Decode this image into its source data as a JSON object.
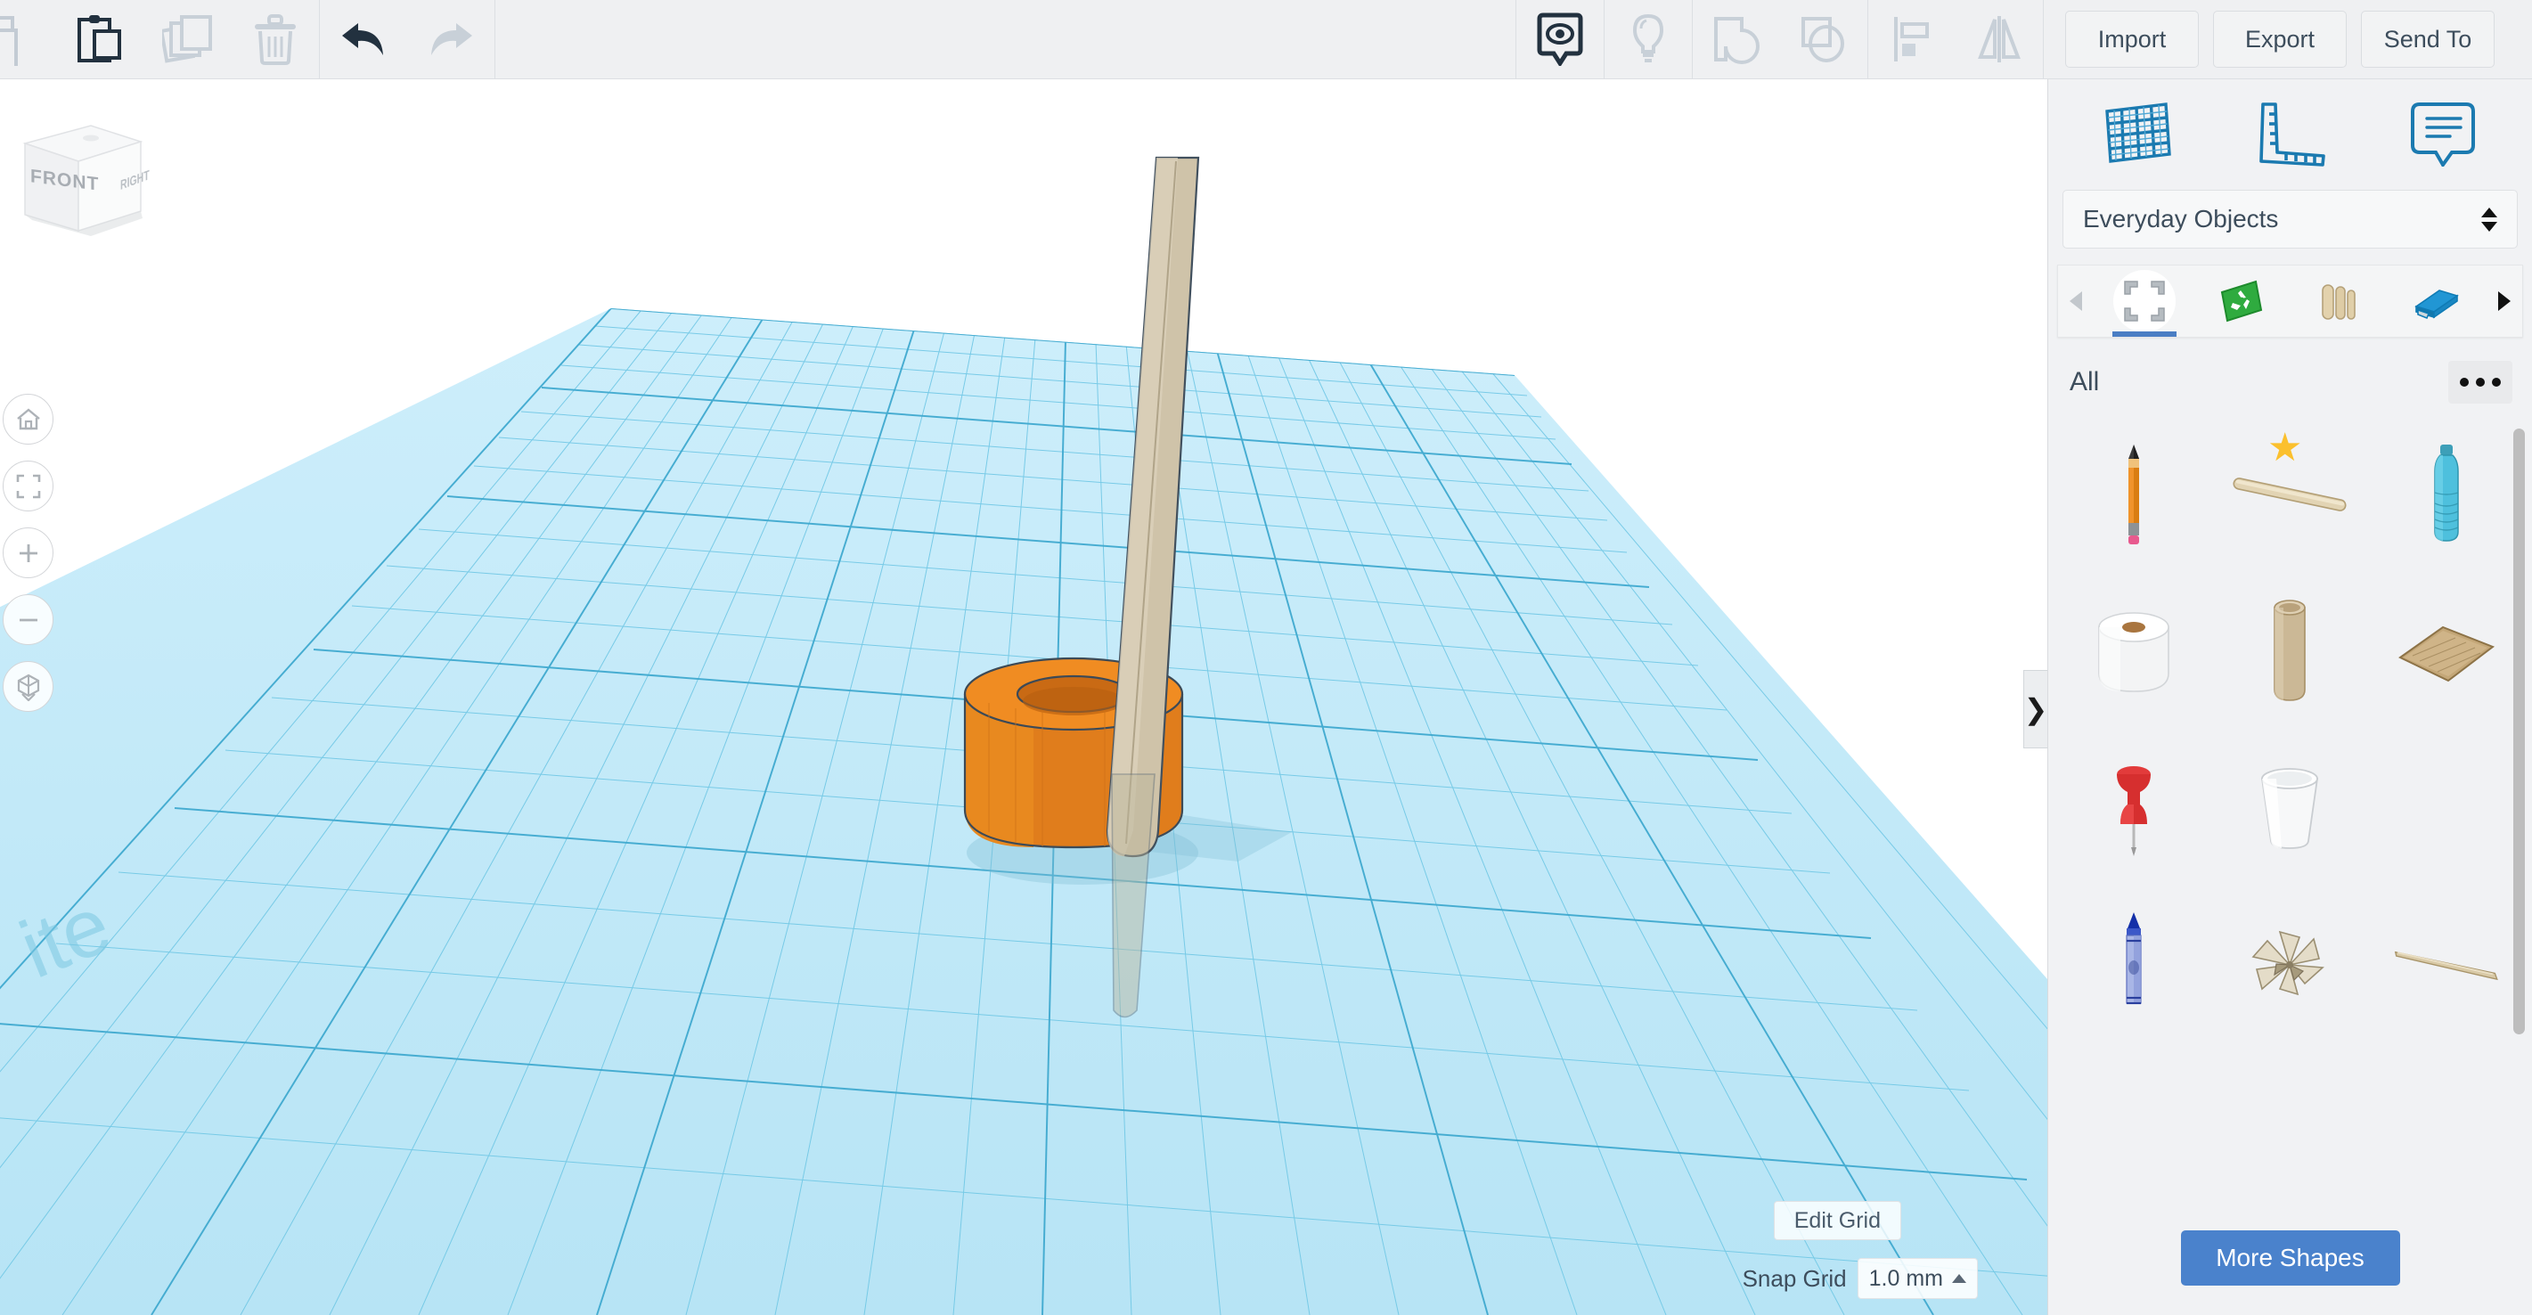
{
  "toolbar": {
    "left_tools": [
      {
        "name": "copy-icon",
        "label": "Copy"
      },
      {
        "name": "paste-icon",
        "label": "Paste"
      },
      {
        "name": "duplicate-icon",
        "label": "Duplicate"
      },
      {
        "name": "delete-icon",
        "label": "Delete"
      }
    ],
    "history_tools": [
      {
        "name": "undo-icon",
        "label": "Undo"
      },
      {
        "name": "redo-icon",
        "label": "Redo"
      }
    ],
    "view_tools": [
      {
        "name": "show-hide-icon",
        "label": "Show/Hide"
      },
      {
        "name": "lightbulb-icon",
        "label": "Light"
      },
      {
        "name": "group-icon",
        "label": "Group"
      },
      {
        "name": "ungroup-icon",
        "label": "Ungroup"
      },
      {
        "name": "align-icon",
        "label": "Align"
      },
      {
        "name": "mirror-icon",
        "label": "Mirror"
      }
    ],
    "actions": [
      {
        "name": "import-button",
        "label": "Import"
      },
      {
        "name": "export-button",
        "label": "Export"
      },
      {
        "name": "send-to-button",
        "label": "Send To"
      }
    ]
  },
  "canvas": {
    "viewcube": {
      "front_label": "FRONT",
      "right_label": "RIGHT"
    },
    "nav_buttons": [
      {
        "name": "home-view-button",
        "icon": "home-icon"
      },
      {
        "name": "fit-to-view-button",
        "icon": "fit-view-icon"
      },
      {
        "name": "zoom-in-button",
        "icon": "plus-icon"
      },
      {
        "name": "zoom-out-button",
        "icon": "minus-icon"
      },
      {
        "name": "projection-toggle-button",
        "icon": "cube-perspective-icon"
      }
    ],
    "collapse_tab": "❯",
    "edit_grid_label": "Edit Grid",
    "snap_grid_label": "Snap Grid",
    "snap_grid_value": "1.0 mm",
    "objects": [
      {
        "name": "orange-tube-object",
        "color": "#E8821E"
      },
      {
        "name": "craft-stick-object",
        "color": "#CFC3AA"
      }
    ],
    "grid_color": "#66c6e5",
    "workplane_color": "#bfe6f5"
  },
  "panel": {
    "tools": [
      {
        "name": "workplane-tool",
        "label": "Workplane"
      },
      {
        "name": "ruler-tool",
        "label": "Ruler"
      },
      {
        "name": "notes-tool",
        "label": "Notes"
      }
    ],
    "category": {
      "label": "Everyday Objects"
    },
    "strip": {
      "prev_arrow": "◀",
      "next_arrow": "▶",
      "items": [
        {
          "name": "basic-shapes-tab",
          "label": "Basic Shapes",
          "active": true
        },
        {
          "name": "recycled-tab",
          "label": "Recycled",
          "active": false
        },
        {
          "name": "craft-sticks-tab",
          "label": "Craft Sticks",
          "active": false
        },
        {
          "name": "stapler-tab",
          "label": "Office",
          "active": false
        }
      ]
    },
    "all_label": "All",
    "more_options_label": "…",
    "shapes": [
      {
        "name": "shape-pencil",
        "label": "Pencil",
        "starred": false
      },
      {
        "name": "shape-craft-stick",
        "label": "Craft Stick",
        "starred": true
      },
      {
        "name": "shape-water-bottle",
        "label": "Water Bottle",
        "starred": false
      },
      {
        "name": "shape-toilet-paper-roll",
        "label": "Toilet Paper Roll",
        "starred": false
      },
      {
        "name": "shape-cardboard-tube",
        "label": "Cardboard Tube",
        "starred": false
      },
      {
        "name": "shape-cardboard-sheet",
        "label": "Cardboard Sheet",
        "starred": false
      },
      {
        "name": "shape-push-pin",
        "label": "Push Pin",
        "starred": false
      },
      {
        "name": "shape-paper-cup",
        "label": "Paper Cup",
        "starred": false
      },
      {
        "name": "shape-crayon",
        "label": "Crayon",
        "starred": false
      },
      {
        "name": "shape-paper-burst",
        "label": "Paper Burst",
        "starred": false
      },
      {
        "name": "shape-toothpick",
        "label": "Toothpick",
        "starred": false
      }
    ],
    "more_shapes_label": "More Shapes"
  },
  "colors": {
    "accent_blue": "#4a82cc",
    "panel_bg": "#f1f2f4",
    "toolbar_bg": "#eff0f2",
    "text": "#3d4d5c",
    "tool_icon_blue": "#1b7ab0"
  }
}
